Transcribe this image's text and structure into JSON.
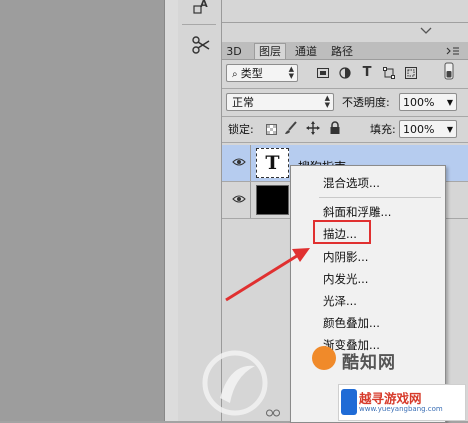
{
  "panel": {
    "tabs": [
      "3D",
      "图层",
      "通道",
      "路径"
    ],
    "filter_select": "类型",
    "blend_mode": "正常",
    "opacity_label": "不透明度:",
    "opacity_value": "100%",
    "lock_label": "锁定:",
    "fill_label": "填充:",
    "fill_value": "100%"
  },
  "layers": [
    {
      "name": "搜狗指南",
      "type": "text",
      "thumb_glyph": "T",
      "selected": true
    },
    {
      "name": "",
      "type": "image",
      "thumb_glyph": "",
      "selected": false
    }
  ],
  "context_menu": {
    "items": [
      "混合选项...",
      "斜面和浮雕...",
      "描边...",
      "内阴影...",
      "内发光...",
      "光泽...",
      "颜色叠加...",
      "渐变叠加..."
    ],
    "highlighted_item": "描边..."
  },
  "watermarks": {
    "site_name": "酷知网",
    "badge_title": "越寻游戏网",
    "badge_url": "www.yueyangbang.com"
  },
  "colors": {
    "highlight": "#e03030",
    "selected_layer": "#b6ccef"
  },
  "icons": [
    "text-tool-icon",
    "scissors-icon",
    "eye-icon",
    "lock-icon",
    "brush-icon",
    "move-icon",
    "link-icon"
  ]
}
